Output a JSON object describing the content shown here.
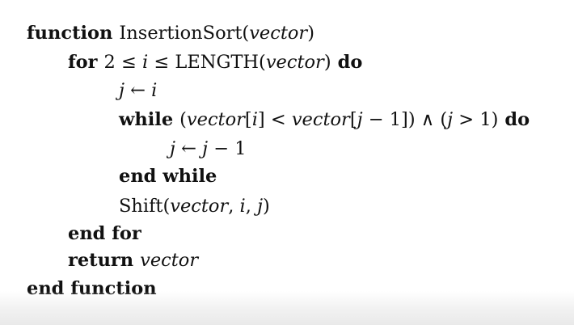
{
  "algorithm": {
    "l1": {
      "kw": "function",
      "name": "InsertionSort(",
      "arg": "vector",
      "close": ")"
    },
    "l2": {
      "kw": "for",
      "a": "2 ≤ ",
      "i": "i",
      "b": " ≤ LENGTH(",
      "vec": "vector",
      "c": ")",
      "kw2": "do"
    },
    "l3": {
      "j": "j",
      "arrow": " ← ",
      "i": "i"
    },
    "l4": {
      "kw": "while",
      "p1": "(",
      "v1": "vector",
      "b1": "[",
      "i": "i",
      "b2": "] < ",
      "v2": "vector",
      "b3": "[",
      "j": "j",
      "b4": " − 1]) ∧ (",
      "j2": "j",
      "b5": " > 1)",
      "kw2": "do"
    },
    "l5": {
      "j": "j",
      "arrow": " ← ",
      "j2": "j",
      "rest": " − 1"
    },
    "l6": {
      "kw": "end while"
    },
    "l7": {
      "name": "Shift(",
      "v": "vector",
      "c1": ", ",
      "i": "i",
      "c2": ", ",
      "j": "j",
      "c3": ")"
    },
    "l8": {
      "kw": "end for"
    },
    "l9": {
      "kw": "return",
      "v": "vector"
    },
    "l10": {
      "kw": "end function"
    }
  }
}
